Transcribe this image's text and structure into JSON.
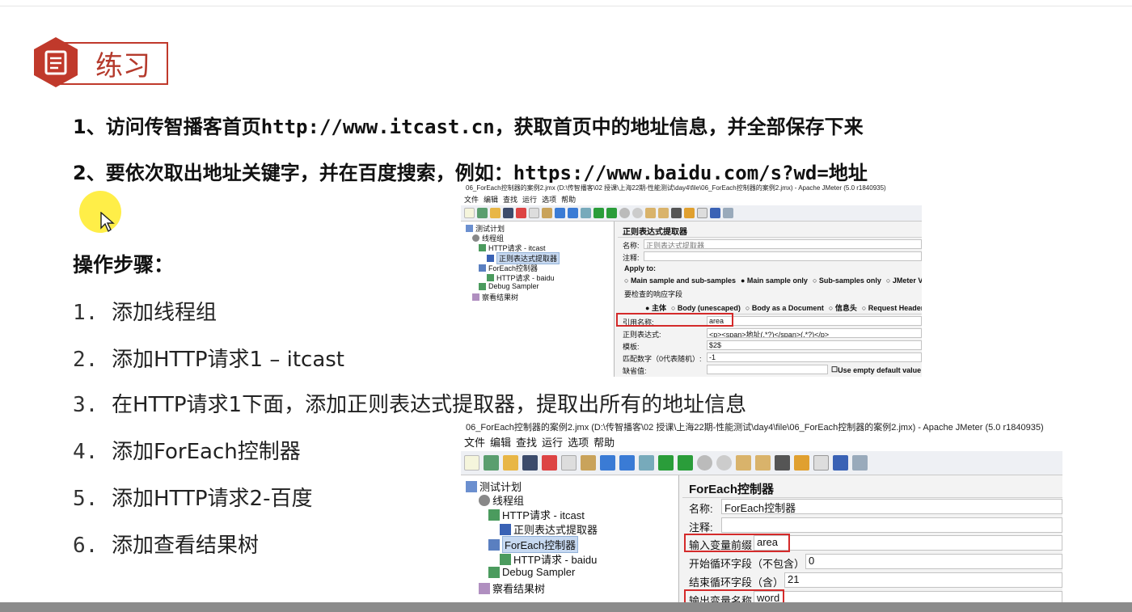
{
  "slide": {
    "title": "练习",
    "tasks": [
      {
        "prefix": "1、访问传智播客首页",
        "url": "http://www.itcast.cn",
        "suffix": "，获取首页中的地址信息，并全部保存下来"
      },
      {
        "prefix": "2、要依次取出地址关键字，并在百度搜索，例如：",
        "url": "https://www.baidu.com/s?wd=地址",
        "suffix": ""
      }
    ],
    "steps_heading": "操作步骤：",
    "steps": [
      {
        "num": "1.",
        "text": "添加线程组"
      },
      {
        "num": "2.",
        "text": "添加HTTP请求1 – itcast"
      },
      {
        "num": "3.",
        "text": "在HTTP请求1下面，添加正则表达式提取器，提取出所有的地址信息"
      },
      {
        "num": "4.",
        "text": "添加ForEach控制器"
      },
      {
        "num": "5.",
        "text": "添加HTTP请求2-百度"
      },
      {
        "num": "6.",
        "text": "添加查看结果树"
      }
    ]
  },
  "jmeter_regex": {
    "window_title": "06_ForEach控制器的案例2.jmx (D:\\传智播客\\02 授课\\上海22期-性能测试\\day4\\file\\06_ForEach控制器的案例2.jmx) - Apache JMeter (5.0 r1840935)",
    "menu": [
      "文件",
      "编辑",
      "查找",
      "运行",
      "选项",
      "帮助"
    ],
    "tree": [
      {
        "label": "测试计划",
        "icon": "test-plan-icon"
      },
      {
        "label": "线程组",
        "icon": "thread-group-icon"
      },
      {
        "label": "HTTP请求 - itcast",
        "icon": "http-sampler-icon"
      },
      {
        "label": "正则表达式提取器",
        "icon": "regex-extractor-icon"
      },
      {
        "label": "ForEach控制器",
        "icon": "foreach-controller-icon"
      },
      {
        "label": "HTTP请求 - baidu",
        "icon": "http-sampler-icon"
      },
      {
        "label": "Debug Sampler",
        "icon": "debug-sampler-icon"
      },
      {
        "label": "察看结果树",
        "icon": "result-tree-icon"
      }
    ],
    "panel": {
      "title": "正则表达式提取器",
      "name_label": "名称:",
      "name_value": "正则表达式提取器",
      "comment_label": "注释:",
      "apply_to": "Apply to:",
      "apply_options": [
        "Main sample and sub-samples",
        "Main sample only",
        "Sub-samples only",
        "JMeter Var"
      ],
      "field_check_label": "要检查的响应字段",
      "field_options": [
        "主体",
        "Body (unescaped)",
        "Body as a Document",
        "信息头",
        "Request Headers"
      ],
      "ref_name_label": "引用名称:",
      "ref_name_value": "area",
      "regex_label": "正则表达式:",
      "regex_value": "<p><span>地址(.*?)</span>(.*?)</p>",
      "template_label": "模板:",
      "template_value": "$2$",
      "match_no_label": "匹配数字（0代表随机）:",
      "match_no_value": "-1",
      "default_label": "缺省值:",
      "default_checkbox": "Use empty default value"
    }
  },
  "jmeter_foreach": {
    "window_title": "06_ForEach控制器的案例2.jmx (D:\\传智播客\\02 授课\\上海22期-性能测试\\day4\\file\\06_ForEach控制器的案例2.jmx) - Apache JMeter (5.0 r1840935)",
    "menu": [
      "文件",
      "编辑",
      "查找",
      "运行",
      "选项",
      "帮助"
    ],
    "tree": [
      {
        "label": "测试计划",
        "icon": "test-plan-icon"
      },
      {
        "label": "线程组",
        "icon": "thread-group-icon"
      },
      {
        "label": "HTTP请求 - itcast",
        "icon": "http-sampler-icon"
      },
      {
        "label": "正则表达式提取器",
        "icon": "regex-extractor-icon"
      },
      {
        "label": "ForEach控制器",
        "icon": "foreach-controller-icon"
      },
      {
        "label": "HTTP请求 - baidu",
        "icon": "http-sampler-icon"
      },
      {
        "label": "Debug Sampler",
        "icon": "debug-sampler-icon"
      },
      {
        "label": "察看结果树",
        "icon": "result-tree-icon"
      }
    ],
    "panel": {
      "title": "ForEach控制器",
      "name_label": "名称:",
      "name_value": "ForEach控制器",
      "comment_label": "注释:",
      "input_prefix_label": "输入变量前缀",
      "input_prefix_value": "area",
      "start_label": "开始循环字段（不包含）",
      "start_value": "0",
      "end_label": "结束循环字段（含）",
      "end_value": "21",
      "output_label": "输出变量名称",
      "output_value": "word"
    }
  },
  "colors": {
    "accent_red": "#c0392b",
    "highlight_red": "#d42a2a",
    "cursor_yellow": "#ffeb28",
    "tree_selection": "#c7d9f1"
  }
}
